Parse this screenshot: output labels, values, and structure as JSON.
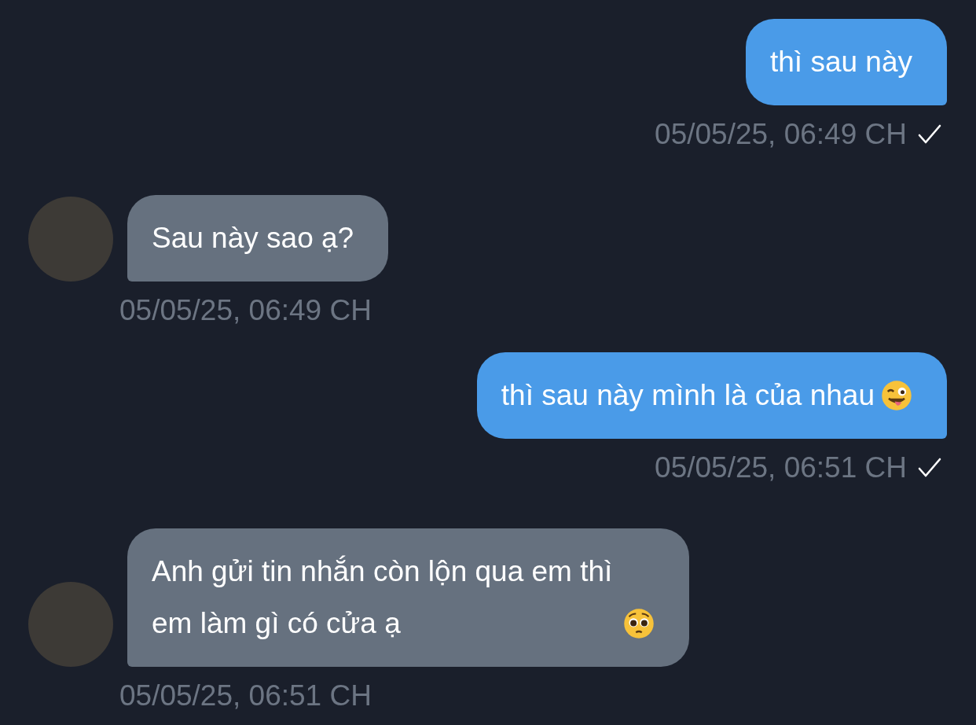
{
  "messages": [
    {
      "kind": "outgoing",
      "text": "thì sau này",
      "time": "05/05/25, 06:49 CH",
      "read": true
    },
    {
      "kind": "incoming",
      "text": "Sau này sao ạ?",
      "time": "05/05/25, 06:49 CH"
    },
    {
      "kind": "outgoing",
      "text": "thì sau này mình là của nhau",
      "emoji": {
        "kind": "wink"
      },
      "time": "05/05/25, 06:51 CH",
      "read": true
    },
    {
      "kind": "incoming",
      "text": "Anh gửi tin nhắn còn lộn qua em thì em làm gì có cửa ạ",
      "emoji": {
        "kind": "pleading"
      },
      "time": "05/05/25, 06:51 CH"
    }
  ]
}
